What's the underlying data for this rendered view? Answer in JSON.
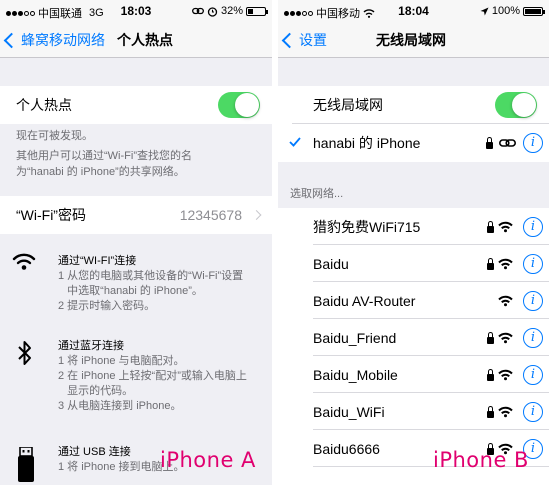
{
  "phone_a": {
    "status": {
      "carrier": "中国联通",
      "network": "3G",
      "time": "18:03",
      "battery": "32%"
    },
    "nav": {
      "back_label": "蜂窝移动网络",
      "title": "个人热点"
    },
    "hotspot_label": "个人热点",
    "footer_lines": [
      "现在可被发现。",
      "其他用户可以通过“Wi-Fi”查找您的名",
      "为“hanabi 的 iPhone”的共享网络。"
    ],
    "password_label": "“Wi-Fi”密码",
    "password_value": "12345678",
    "methods": [
      {
        "icon": "wifi-icon",
        "title": "通过“WI-FI”连接",
        "steps": [
          "1 从您的电脑或其他设备的“Wi-Fi”设置",
          "   中选取“hanabi 的 iPhone”。",
          "2 提示时输入密码。"
        ]
      },
      {
        "icon": "bluetooth-icon",
        "title": "通过蓝牙连接",
        "steps": [
          "1 将 iPhone 与电脑配对。",
          "2 在 iPhone 上轻按“配对”或输入电脑上",
          "   显示的代码。",
          "3 从电脑连接到 iPhone。"
        ]
      },
      {
        "icon": "usb-icon",
        "title": "通过 USB 连接",
        "steps": [
          "1 将 iPhone 接到电脑上。"
        ]
      }
    ],
    "caption": "iPhone A"
  },
  "phone_b": {
    "status": {
      "carrier": "中国移动",
      "time": "18:04",
      "battery": "100%"
    },
    "nav": {
      "back_label": "设置",
      "title": "无线局域网"
    },
    "wlan_label": "无线局域网",
    "connected_network": "hanabi 的 iPhone",
    "choose_header": "选取网络...",
    "networks": [
      {
        "name": "猎豹免费WiFi715",
        "locked": true
      },
      {
        "name": "Baidu",
        "locked": true
      },
      {
        "name": "Baidu AV-Router",
        "locked": false
      },
      {
        "name": "Baidu_Friend",
        "locked": true
      },
      {
        "name": "Baidu_Mobile",
        "locked": true
      },
      {
        "name": "Baidu_WiFi",
        "locked": true
      },
      {
        "name": "Baidu6666",
        "locked": true
      }
    ],
    "caption": "iPhone B"
  },
  "colors": {
    "accent": "#007aff",
    "switch_on": "#4cd964",
    "caption": "#e0006f"
  }
}
